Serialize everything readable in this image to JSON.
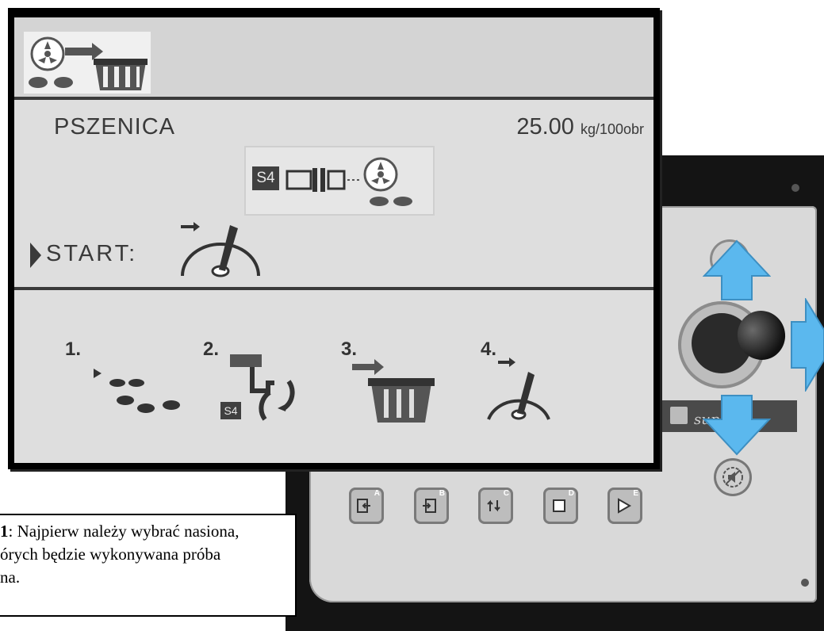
{
  "screen": {
    "header_icon": "seed-to-bucket-icon",
    "seed_name": "PSZENICA",
    "rate_value": "25.00",
    "rate_unit": "kg/100obr",
    "sensor_badge": "S4",
    "start_label": "START:",
    "steps": [
      {
        "number": "1.",
        "icon": "select-seeds-icon"
      },
      {
        "number": "2.",
        "icon": "rotate-shaft-icon",
        "badge": "S4"
      },
      {
        "number": "3.",
        "icon": "collect-bucket-icon"
      },
      {
        "number": "4.",
        "icon": "start-lever-icon"
      }
    ]
  },
  "device": {
    "brand_fragment": "sup",
    "softkeys": [
      "A",
      "B",
      "C",
      "D",
      "E"
    ],
    "arrow_color": "#5bb8ee"
  },
  "caption": {
    "line1_bold": "1",
    "line1_rest": ": Najpierw należy wybrać nasiona,",
    "line2": "órych będzie wykonywana próba",
    "line3": "na."
  }
}
